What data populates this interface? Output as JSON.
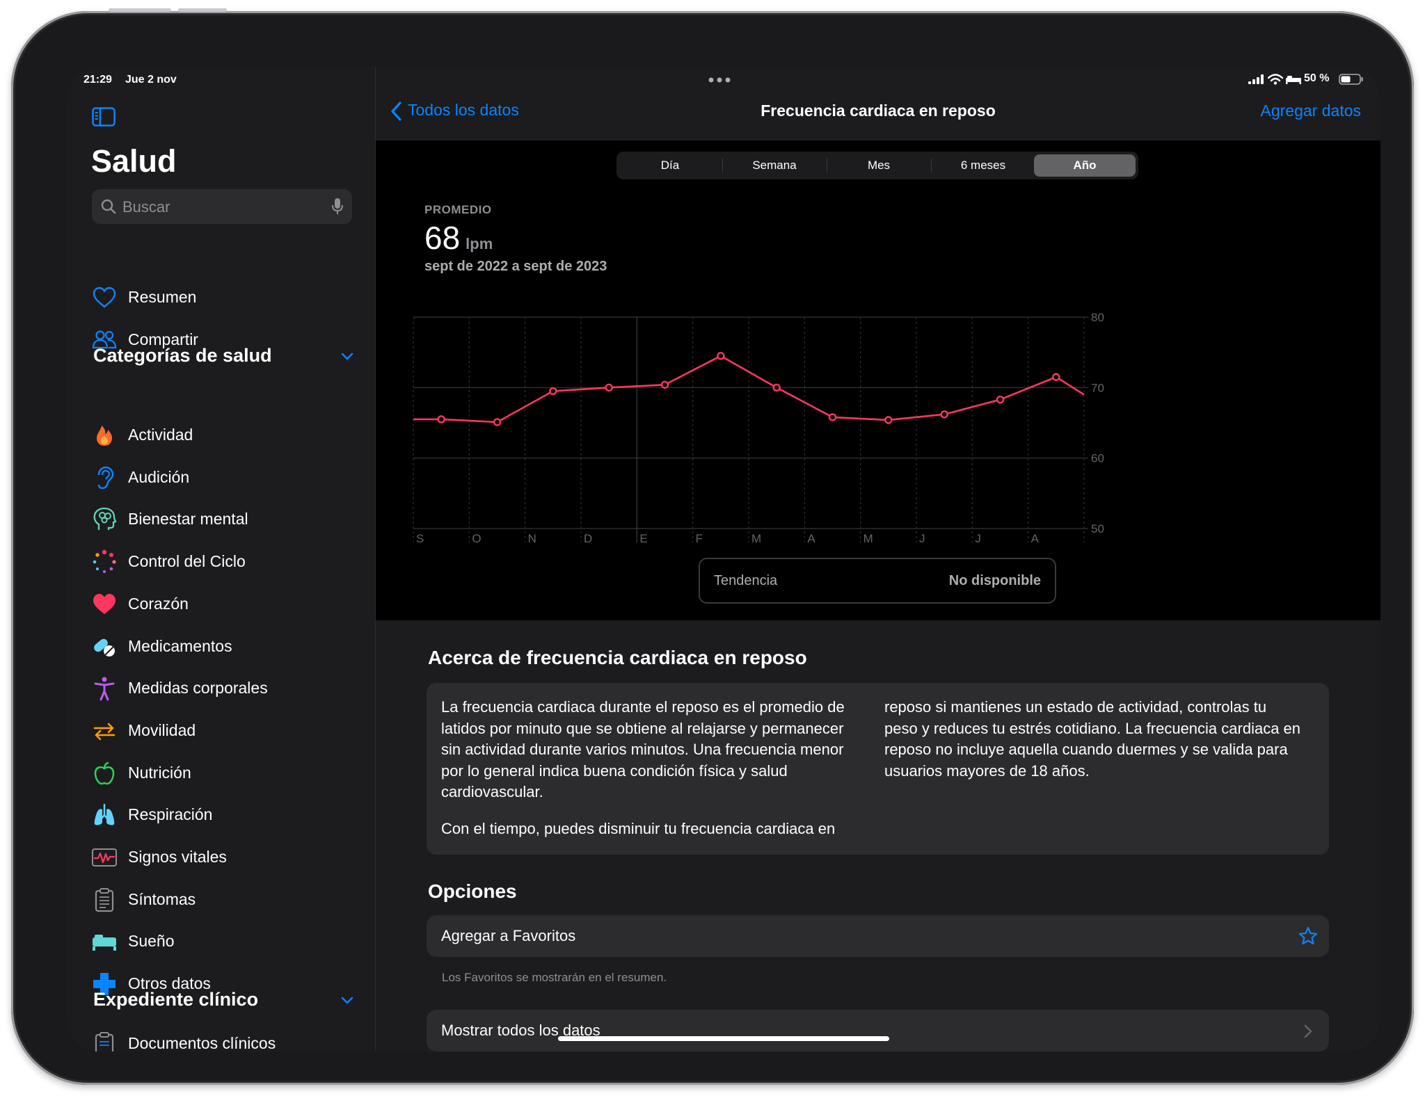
{
  "status_bar": {
    "time": "21:29",
    "date": "Jue 2 nov",
    "battery": "50 %"
  },
  "sidebar": {
    "title": "Salud",
    "search_placeholder": "Buscar",
    "top_items": [
      {
        "label": "Resumen",
        "icon": "heart-outline-icon",
        "color": "#0a84ff"
      },
      {
        "label": "Compartir",
        "icon": "people-icon",
        "color": "#0a84ff"
      }
    ],
    "section1_title": "Categorías de salud",
    "categories": [
      {
        "label": "Actividad",
        "icon": "flame-icon",
        "color": "#ff6b2c"
      },
      {
        "label": "Audición",
        "icon": "ear-icon",
        "color": "#0a84ff"
      },
      {
        "label": "Bienestar mental",
        "icon": "brain-head-icon",
        "color": "#5fd7b9"
      },
      {
        "label": "Control del Ciclo",
        "icon": "cycle-dots-icon",
        "color": "#ff375f"
      },
      {
        "label": "Corazón",
        "icon": "heart-icon",
        "color": "#ff375f"
      },
      {
        "label": "Medicamentos",
        "icon": "pills-icon",
        "color": "#64d2ff"
      },
      {
        "label": "Medidas corporales",
        "icon": "figure-icon",
        "color": "#bf5af2"
      },
      {
        "label": "Movilidad",
        "icon": "arrows-icon",
        "color": "#ff9f0a"
      },
      {
        "label": "Nutrición",
        "icon": "apple-icon",
        "color": "#30d158"
      },
      {
        "label": "Respiración",
        "icon": "lungs-icon",
        "color": "#64d2ff"
      },
      {
        "label": "Signos vitales",
        "icon": "waveform-icon",
        "color": "#ff375f"
      },
      {
        "label": "Síntomas",
        "icon": "clipboard-icon",
        "color": "#8e8e93"
      },
      {
        "label": "Sueño",
        "icon": "bed-icon",
        "color": "#5fd7d7"
      },
      {
        "label": "Otros datos",
        "icon": "plus-icon",
        "color": "#0a84ff"
      }
    ],
    "section2_title": "Expediente clínico",
    "clinical_items": [
      {
        "label": "Documentos clínicos",
        "icon": "document-icon",
        "color": "#8e8e93"
      }
    ]
  },
  "nav": {
    "back_label": "Todos los datos",
    "title": "Frecuencia cardiaca en reposo",
    "add_label": "Agregar datos"
  },
  "segments": [
    "Día",
    "Semana",
    "Mes",
    "6 meses",
    "Año"
  ],
  "selected_segment": "Año",
  "summary": {
    "label": "PROMEDIO",
    "value": "68",
    "unit": "lpm",
    "range": "sept de 2022 a sept de 2023"
  },
  "chart_data": {
    "type": "line",
    "categories": [
      "S",
      "O",
      "N",
      "D",
      "E",
      "F",
      "M",
      "A",
      "M",
      "J",
      "J",
      "A"
    ],
    "series": [
      {
        "color": "#ff375f",
        "values": [
          65.5,
          65.1,
          69.5,
          70.0,
          70.4,
          74.5,
          70.0,
          65.8,
          65.4,
          66.2,
          68.3,
          71.5
        ]
      }
    ],
    "y_ticks": [
      80,
      70,
      60,
      50
    ],
    "ylim": [
      50,
      80
    ],
    "grid": true
  },
  "trend": {
    "label": "Tendencia",
    "value": "No disponible"
  },
  "about": {
    "title": "Acerca de frecuencia cardiaca en reposo",
    "col1_p1": "La frecuencia cardiaca durante el reposo es el promedio de latidos por minuto que se obtiene al relajarse y permanecer sin actividad durante varios minutos. Una frecuencia menor por lo general indica buena condición física y salud cardiovascular.",
    "col1_p2": "Con el tiempo, puedes disminuir tu frecuencia cardiaca en",
    "col2": "reposo si mantienes un estado de actividad, controlas tu peso y reduces tu estrés cotidiano. La frecuencia cardiaca en reposo no incluye aquella cuando duermes y se valida para usuarios mayores de 18 años."
  },
  "options": {
    "title": "Opciones",
    "favorites_label": "Agregar a Favoritos",
    "favorites_note": "Los Favoritos se mostrarán en el resumen.",
    "show_all_label": "Mostrar todos los datos"
  }
}
